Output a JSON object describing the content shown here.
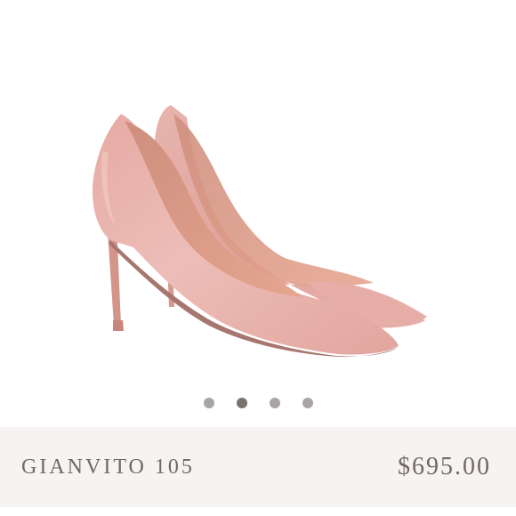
{
  "product": {
    "title": "GIANVITO 105",
    "price": "$695.00",
    "image_alt": "pink satin pointed-toe pumps"
  },
  "carousel": {
    "total_slides": 4,
    "active_slide": 2
  },
  "colors": {
    "shoe_pink": "#e6aea8",
    "info_bar_bg": "#f7f3f2",
    "text": "#6f6867",
    "dot": "#a9a5a4",
    "dot_active": "#7a716e"
  }
}
